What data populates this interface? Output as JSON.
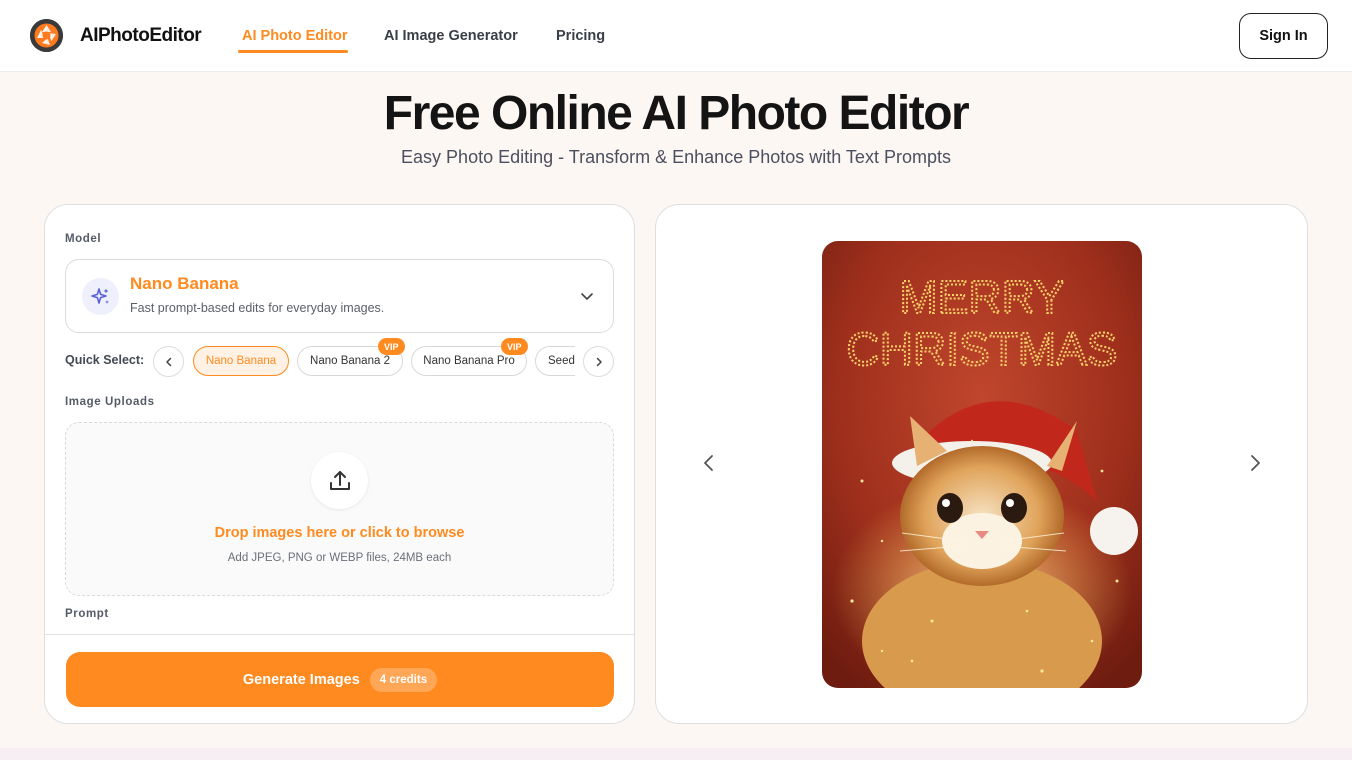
{
  "header": {
    "brand": "AIPhotoEditor",
    "logo_icon": "aperture-icon",
    "nav": [
      {
        "label": "AI Photo Editor",
        "active": true
      },
      {
        "label": "AI Image Generator",
        "active": false
      },
      {
        "label": "Pricing",
        "active": false
      }
    ],
    "signin_label": "Sign In"
  },
  "hero": {
    "title": "Free Online AI Photo Editor",
    "subtitle": "Easy Photo Editing - Transform & Enhance Photos with Text Prompts"
  },
  "editor": {
    "model_label": "Model",
    "model": {
      "icon": "sparkles-icon",
      "name": "Nano Banana",
      "description": "Fast prompt-based edits for everyday images."
    },
    "quick_select_label": "Quick Select:",
    "quick_select": [
      {
        "label": "Nano Banana",
        "vip": false,
        "active": true
      },
      {
        "label": "Nano Banana 2",
        "vip": true,
        "active": false
      },
      {
        "label": "Nano Banana Pro",
        "vip": true,
        "active": false
      },
      {
        "label": "Seed",
        "vip": false,
        "active": false
      }
    ],
    "vip_badge": "VIP",
    "uploads_label": "Image Uploads",
    "upload": {
      "icon": "upload-icon",
      "title": "Drop images here or click to browse",
      "hint": "Add JPEG, PNG or WEBP files, 24MB each"
    },
    "prompt_label": "Prompt",
    "generate_label": "Generate Images",
    "credits_label": "4 credits"
  },
  "preview": {
    "image_text_line1": "MERRY",
    "image_text_line2": "CHRISTMAS"
  },
  "colors": {
    "accent": "#ff8a1f",
    "background": "#fdf7f3"
  }
}
